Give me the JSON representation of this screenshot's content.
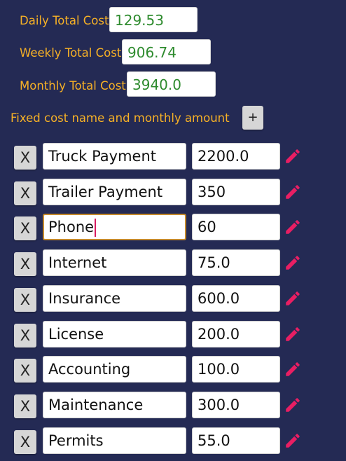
{
  "totals": {
    "daily_label": "Daily Total Cost",
    "daily_value": "129.53",
    "weekly_label": "Weekly Total Cost",
    "weekly_value": "906.74",
    "monthly_label": "Monthly Total Cost",
    "monthly_value": "3940.0"
  },
  "fixed_costs": {
    "header_label": "Fixed cost name and monthly amount",
    "add_label": "+",
    "remove_label": "X",
    "items": [
      {
        "name": "Truck Payment",
        "amount": "2200.0"
      },
      {
        "name": "Trailer Payment",
        "amount": "350"
      },
      {
        "name": "Phone",
        "amount": "60"
      },
      {
        "name": "Internet",
        "amount": "75.0"
      },
      {
        "name": "Insurance",
        "amount": "600.0"
      },
      {
        "name": "License",
        "amount": "200.0"
      },
      {
        "name": "Accounting",
        "amount": "100.0"
      },
      {
        "name": "Maintenance",
        "amount": "300.0"
      },
      {
        "name": "Permits",
        "amount": "55.0"
      }
    ]
  },
  "icons": {
    "edit": "pencil-icon"
  },
  "colors": {
    "background": "#242a54",
    "label": "#f7b126",
    "total_value": "#2e8b2e",
    "edit_icon": "#e91e63",
    "focus_border": "#c58a2c"
  }
}
